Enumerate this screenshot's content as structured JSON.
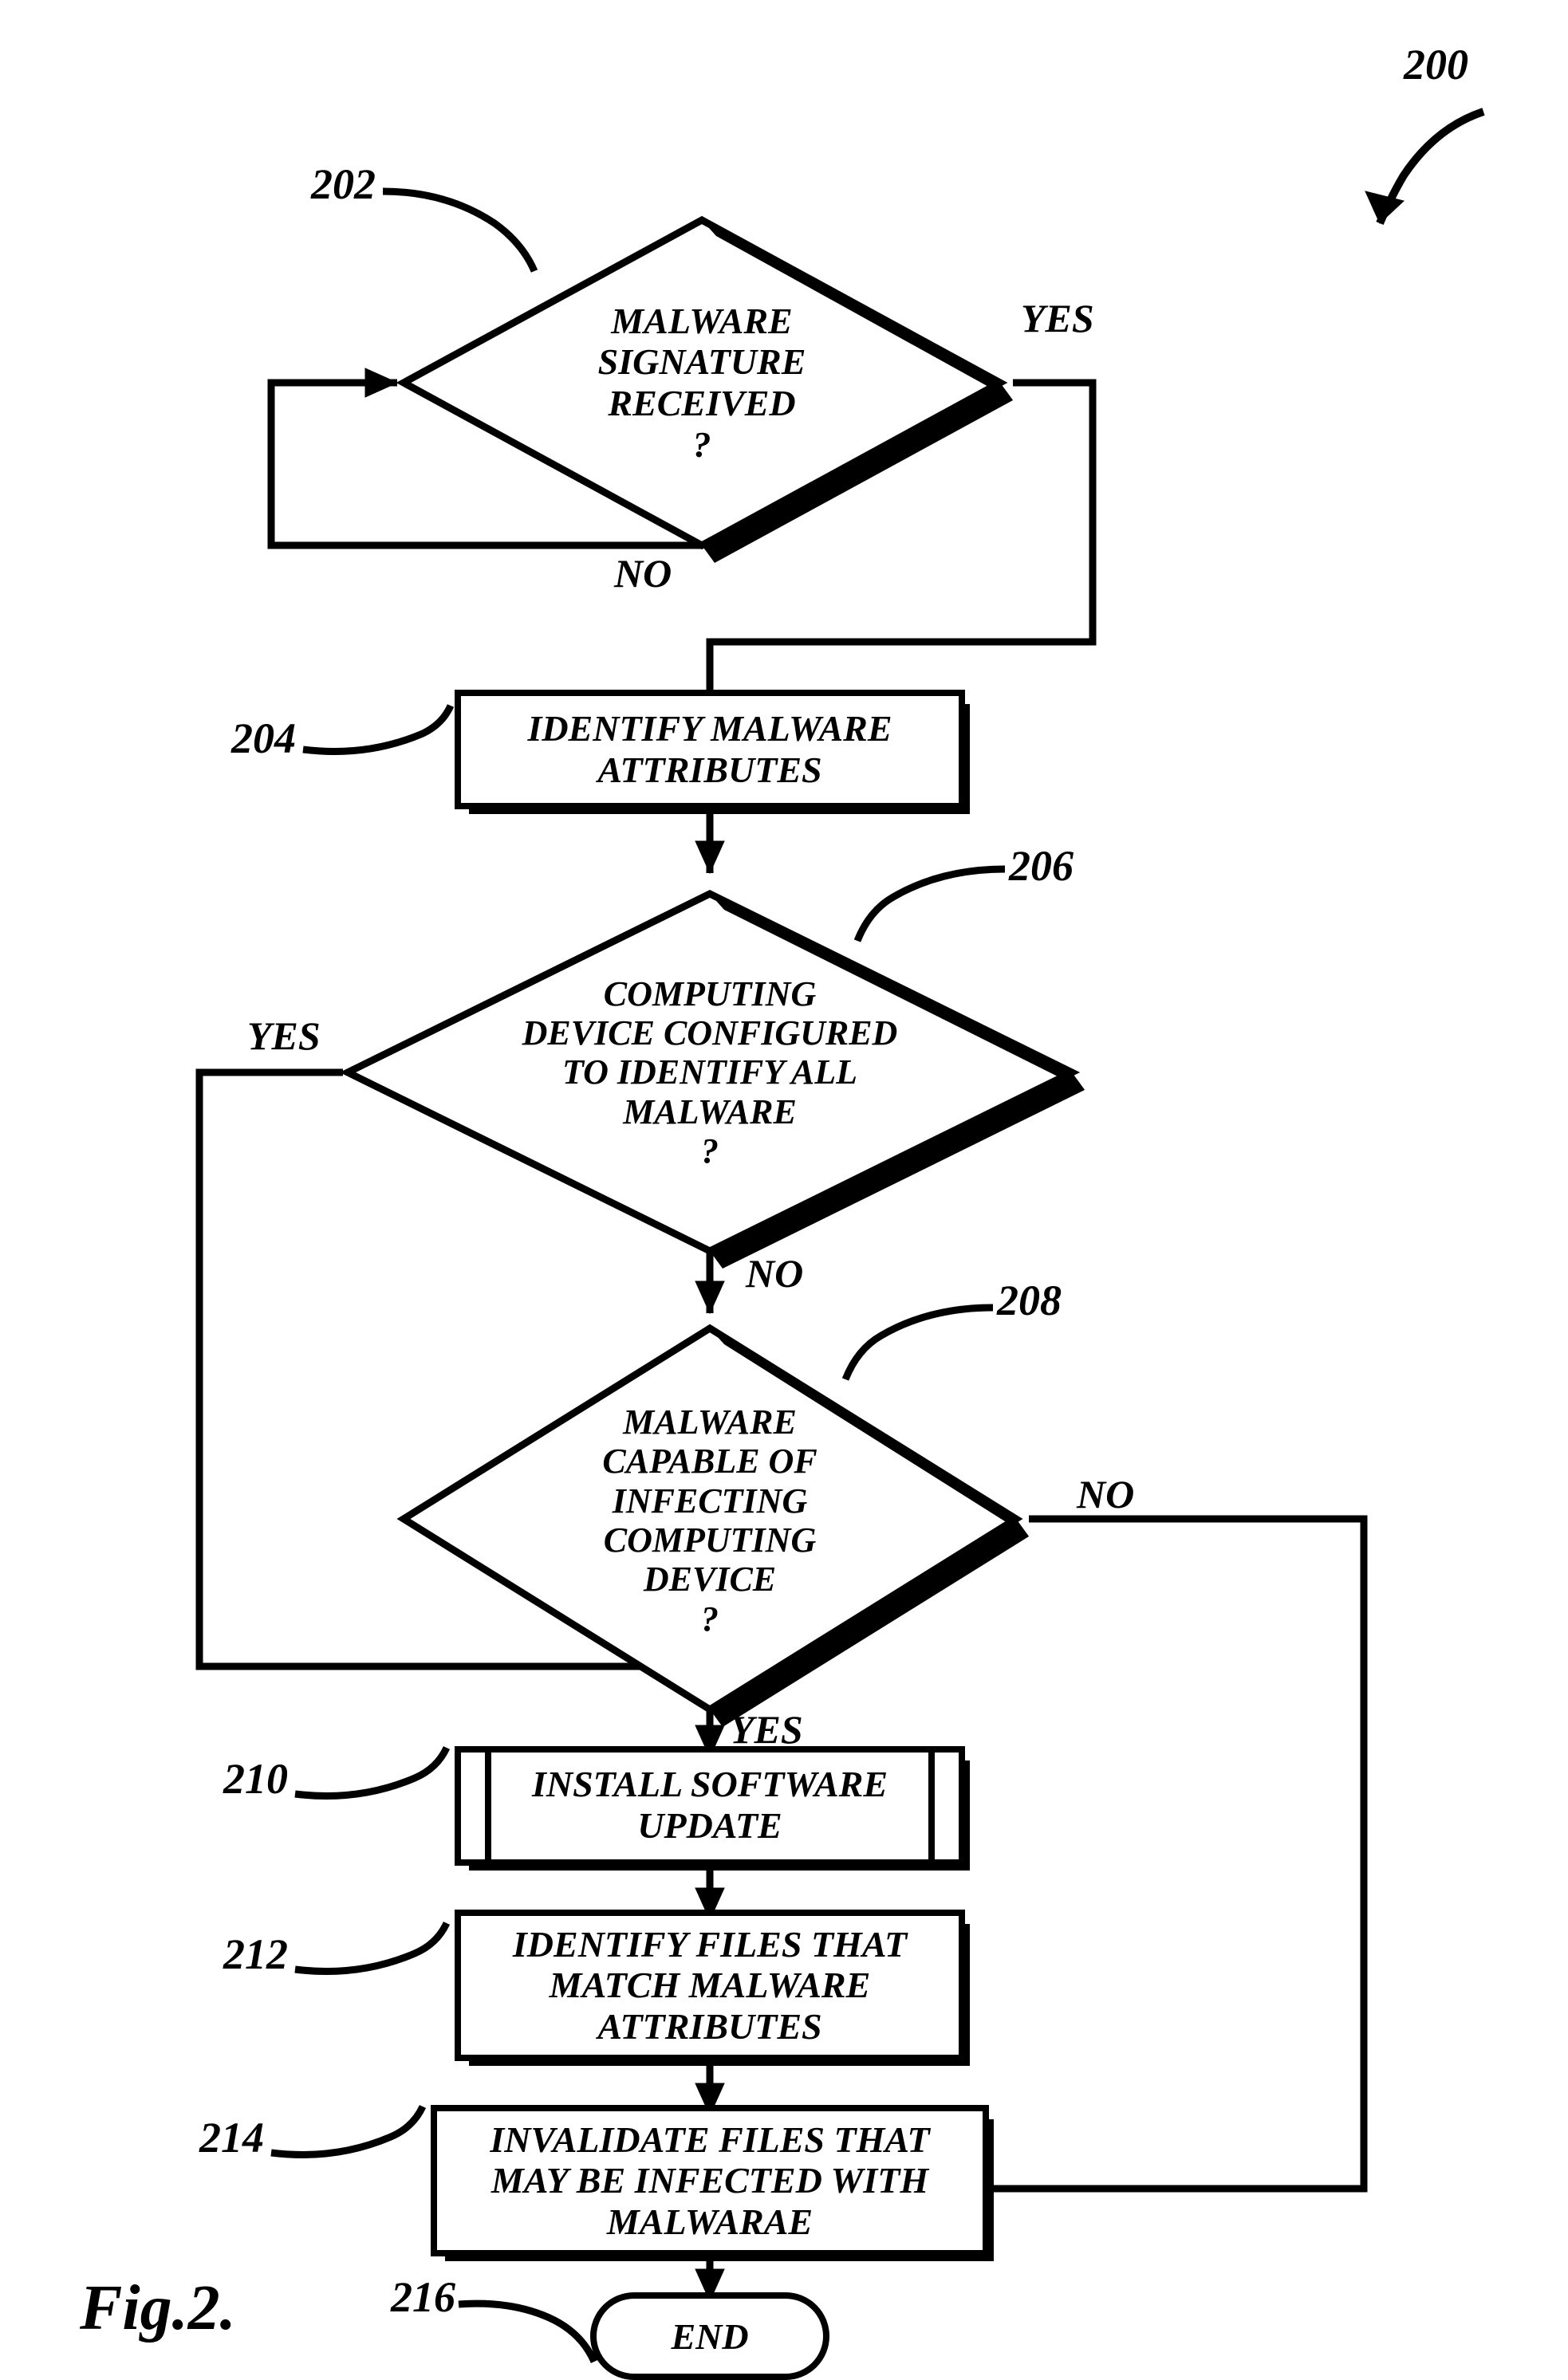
{
  "figure_number_label": "200",
  "nodes": {
    "d202": {
      "ref": "202",
      "text": "MALWARE\nSIGNATURE\nRECEIVED\n?",
      "yes": "YES",
      "no": "NO"
    },
    "r204": {
      "ref": "204",
      "text": "IDENTIFY MALWARE\nATTRIBUTES"
    },
    "d206": {
      "ref": "206",
      "text": "COMPUTING\nDEVICE CONFIGURED\nTO IDENTIFY ALL\nMALWARE\n?",
      "yes": "YES",
      "no": "NO"
    },
    "d208": {
      "ref": "208",
      "text": "MALWARE\nCAPABLE OF\nINFECTING\nCOMPUTING\nDEVICE\n?",
      "yes": "YES",
      "no": "NO"
    },
    "r210": {
      "ref": "210",
      "text": "INSTALL SOFTWARE\nUPDATE"
    },
    "r212": {
      "ref": "212",
      "text": "IDENTIFY FILES THAT\nMATCH MALWARE\nATTRIBUTES"
    },
    "r214": {
      "ref": "214",
      "text": "INVALIDATE FILES THAT\nMAY BE INFECTED WITH\nMALWARAE"
    },
    "end": {
      "ref": "216",
      "text": "END"
    }
  },
  "figure_caption": "Fig.2."
}
